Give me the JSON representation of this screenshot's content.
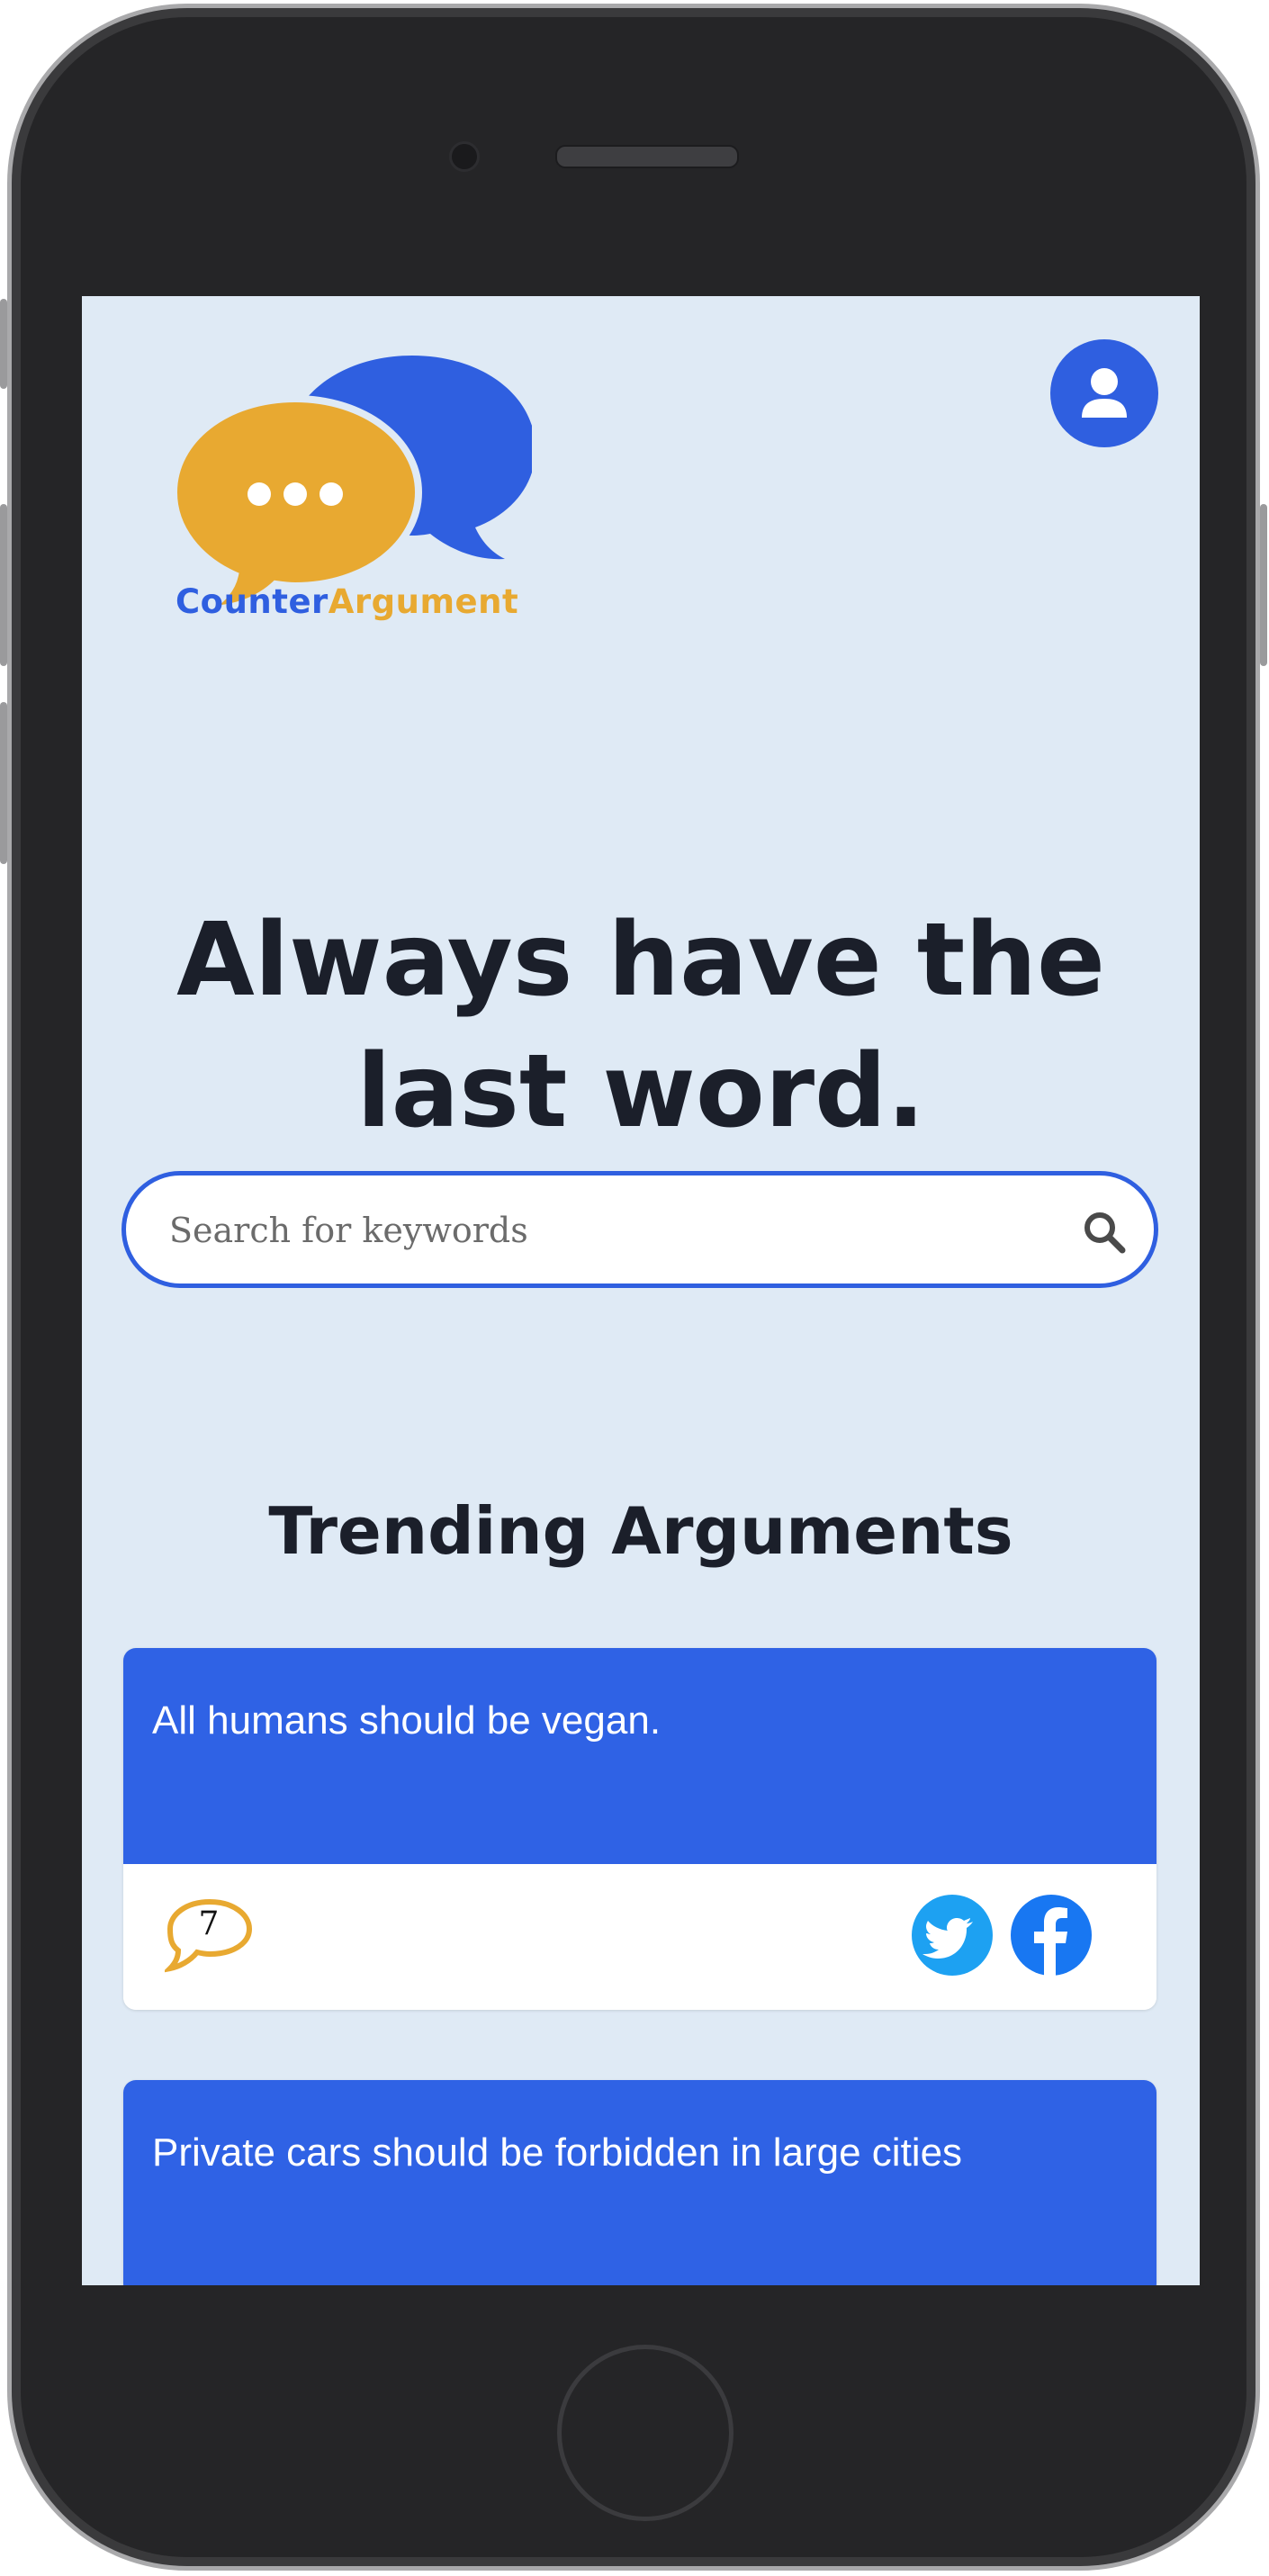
{
  "brand": {
    "name_part1": "Counter",
    "name_part2": "Argument"
  },
  "hero": {
    "headline": "Always have the last word."
  },
  "search": {
    "placeholder": "Search for keywords"
  },
  "trending": {
    "title": "Trending Arguments",
    "cards": [
      {
        "text": "All humans should be vegan.",
        "comments": "7"
      },
      {
        "text": "Private cars should be forbidden in large cities"
      }
    ]
  },
  "colors": {
    "primary_blue": "#2f5fe0",
    "accent_gold": "#e8a931",
    "background": "#dfeaf5",
    "heading": "#1b1f2a"
  },
  "icons": [
    "user-icon",
    "search-icon",
    "comment-icon",
    "twitter-icon",
    "facebook-icon"
  ]
}
